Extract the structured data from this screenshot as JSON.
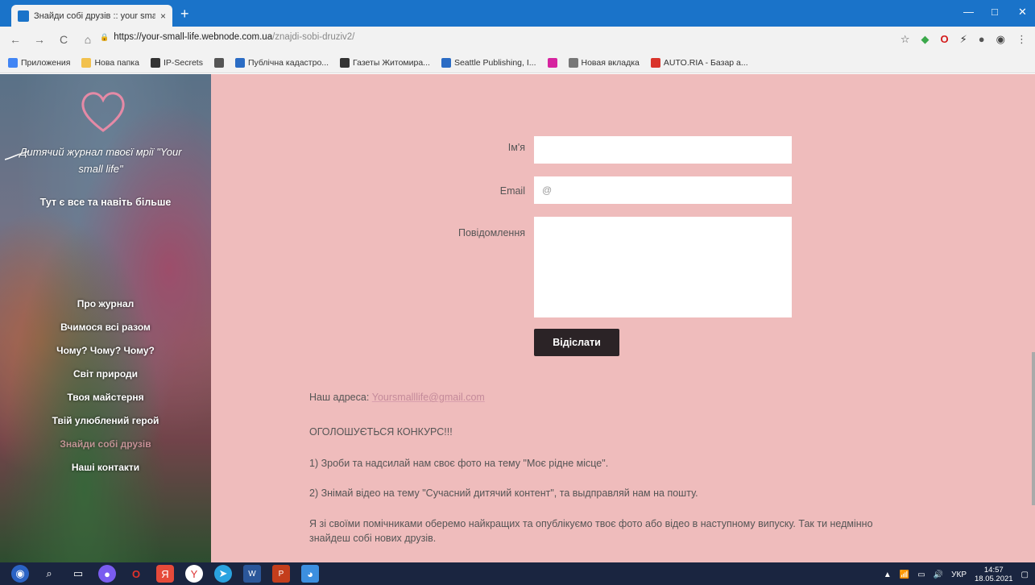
{
  "browser": {
    "tab_title": "Знайди собі друзів :: your small",
    "tab_close": "×",
    "new_tab": "+",
    "win_min": "—",
    "win_max": "□",
    "win_close": "✕",
    "back": "←",
    "forward": "→",
    "reload": "C",
    "home": "⌂",
    "lock": "🔒",
    "url_host": "https://your-small-life.webnode.com.ua",
    "url_path": "/znajdi-sobi-druziv2/",
    "star": "☆"
  },
  "bookmarks": [
    {
      "label": "Приложения",
      "color": "#4285f4"
    },
    {
      "label": "Нова папка",
      "color": "#f2c14e"
    },
    {
      "label": "IP-Secrets",
      "color": "#333333"
    },
    {
      "label": "",
      "color": "#555555"
    },
    {
      "label": "Публічна кадастро...",
      "color": "#2b6cc4"
    },
    {
      "label": "Газеты Житомира...",
      "color": "#333333"
    },
    {
      "label": "Seattle Publishing, I...",
      "color": "#2b6cc4"
    },
    {
      "label": "",
      "color": "#d6249f"
    },
    {
      "label": "Новая вкладка",
      "color": "#777777"
    },
    {
      "label": "AUTO.RIA - Базар а...",
      "color": "#d9342b"
    }
  ],
  "sidebar": {
    "logo_title": "Дитячий журнал твоєї мрії \"Your small life\"",
    "tagline": "Тут є все та навіть більше",
    "menu": [
      {
        "label": "Про журнал",
        "active": false
      },
      {
        "label": "Вчимося всі разом",
        "active": false
      },
      {
        "label": "Чому? Чому? Чому?",
        "active": false
      },
      {
        "label": "Світ природи",
        "active": false
      },
      {
        "label": "Твоя майстерня",
        "active": false
      },
      {
        "label": "Твій улюблений герой",
        "active": false
      },
      {
        "label": "Знайди собі друзів",
        "active": true
      },
      {
        "label": "Наші контакти",
        "active": false
      }
    ]
  },
  "form": {
    "name_label": "Ім'я",
    "email_label": "Email",
    "email_placeholder": "@",
    "message_label": "Повідомлення",
    "send_label": "Відіслати"
  },
  "content": {
    "address_prefix": "Наш адреса: ",
    "address_email": "Yoursmalllife@gmail.com",
    "announcement": "ОГОЛОШУЄТЬСЯ КОНКУРС!!!",
    "item1": "1) Зроби та надсилай нам своє фото на тему \"Моє рідне місце\".",
    "item2": "2) Знімай відео на тему \"Сучасний дитячий контент\", та выдправляй нам на пошту.",
    "closing": "Я зі своїми помічниками оберемо найкращих та опублікуємо твоє фото або відео в наступному випуску. Так ти недмінно знайдеш собі нових друзів."
  },
  "taskbar": {
    "lang": "УКР",
    "time": "14:57",
    "date": "18.05.2021"
  }
}
